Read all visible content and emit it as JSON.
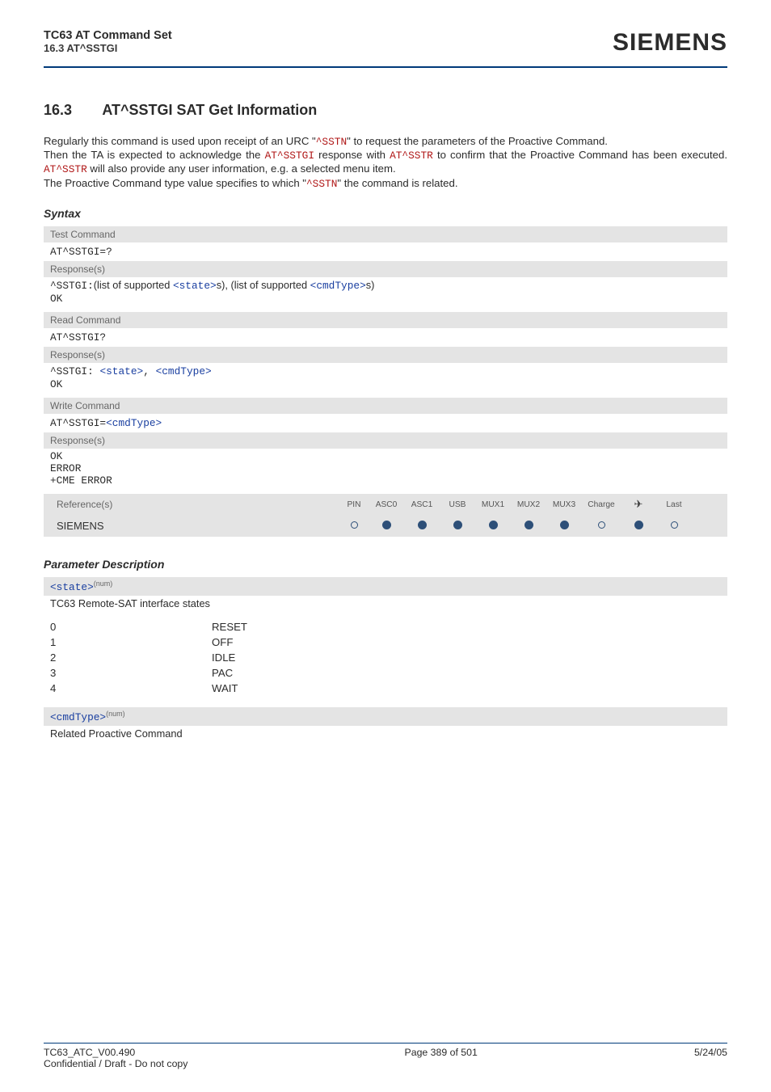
{
  "header": {
    "line1": "TC63 AT Command Set",
    "line2": "16.3 AT^SSTGI",
    "brand": "SIEMENS"
  },
  "section": {
    "number": "16.3",
    "title": "AT^SSTGI   SAT Get Information"
  },
  "para": {
    "p1a": "Regularly this command is used upon receipt of an URC \"",
    "p1_link1": "^SSTN",
    "p1b": "\" to request the parameters of the Proactive Command.",
    "p2a": "Then the TA is expected to acknowledge the ",
    "p2_link1": "AT^SSTGI",
    "p2b": " response with ",
    "p2_link2": "AT^SSTR",
    "p2c": " to confirm that the Proactive Command has been executed. ",
    "p2_link3": "AT^SSTR",
    "p2d": " will also provide any user information, e.g. a selected menu item.",
    "p3a": "The Proactive Command type value specifies to which \"",
    "p3_link1": "^SSTN",
    "p3b": "\" the command is related."
  },
  "syntax_label": "Syntax",
  "syntax": {
    "test_label": "Test Command",
    "test_cmd": "AT^SSTGI=?",
    "resp_label": "Response(s)",
    "test_resp_pre": "^SSTGI:",
    "test_resp_mid1": "(list of supported ",
    "test_resp_state": "<state>",
    "test_resp_mid2": "s), (list of supported ",
    "test_resp_cmd": "<cmdType>",
    "test_resp_end": "s)",
    "ok": "OK",
    "read_label": "Read Command",
    "read_cmd": "AT^SSTGI?",
    "read_resp_pre": "^SSTGI: ",
    "read_resp_state": "<state>",
    "read_resp_sep": ", ",
    "read_resp_cmd": "<cmdType>",
    "write_label": "Write Command",
    "write_cmd_pre": "AT^SSTGI=",
    "write_cmd_arg": "<cmdType>",
    "write_ok": "OK",
    "write_err": "ERROR",
    "write_cme": "+CME ERROR",
    "ref_label": "Reference(s)",
    "ref_headers": [
      "PIN",
      "ASC0",
      "ASC1",
      "USB",
      "MUX1",
      "MUX2",
      "MUX3",
      "Charge",
      "✈",
      "Last"
    ],
    "ref_source": "SIEMENS",
    "ref_dots": [
      "circ",
      "dot",
      "dot",
      "dot",
      "dot",
      "dot",
      "dot",
      "circ",
      "dot",
      "circ"
    ]
  },
  "paramdesc_label": "Parameter Description",
  "state_param": {
    "tag": "<state>",
    "sup": "(num)",
    "caption": "TC63 Remote-SAT interface states",
    "rows": [
      {
        "k": "0",
        "v": "RESET"
      },
      {
        "k": "1",
        "v": "OFF"
      },
      {
        "k": "2",
        "v": "IDLE"
      },
      {
        "k": "3",
        "v": "PAC"
      },
      {
        "k": "4",
        "v": "WAIT"
      }
    ]
  },
  "cmdtype_param": {
    "tag": "<cmdType>",
    "sup": "(num)",
    "caption": "Related Proactive Command"
  },
  "footer": {
    "left1": "TC63_ATC_V00.490",
    "left2": "Confidential / Draft - Do not copy",
    "center": "Page 389 of 501",
    "right": "5/24/05"
  }
}
